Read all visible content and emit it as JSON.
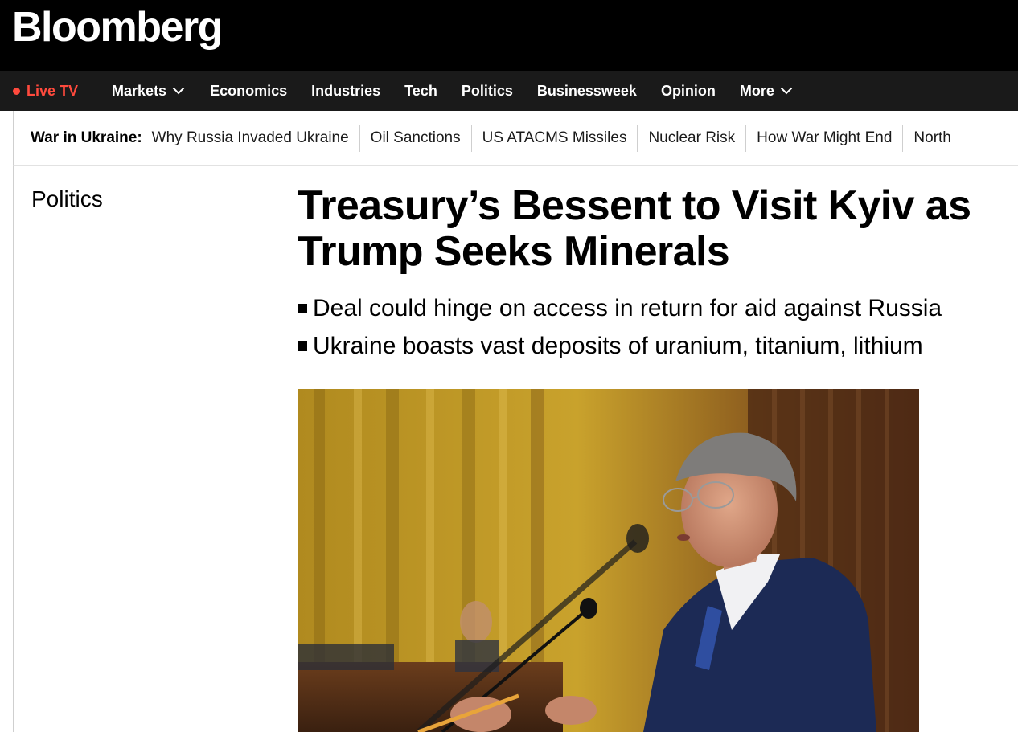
{
  "brand": {
    "logo": "Bloomberg"
  },
  "nav": {
    "live_tv": "Live TV",
    "items": [
      {
        "label": "Markets",
        "dropdown": true
      },
      {
        "label": "Economics"
      },
      {
        "label": "Industries"
      },
      {
        "label": "Tech"
      },
      {
        "label": "Politics"
      },
      {
        "label": "Businessweek"
      },
      {
        "label": "Opinion"
      },
      {
        "label": "More",
        "dropdown": true
      }
    ]
  },
  "topic_strip": {
    "label": "War in Ukraine:",
    "links": [
      "Why Russia Invaded Ukraine",
      "Oil Sanctions",
      "US ATACMS Missiles",
      "Nuclear Risk",
      "How War Might End",
      "North"
    ]
  },
  "article": {
    "section": "Politics",
    "headline": "Treasury’s Bessent to Visit Kyiv as Trump Seeks Minerals",
    "bullets": [
      "Deal could hinge on access in return for aid against Russia",
      "Ukraine boasts vast deposits of uranium, titanium, lithium"
    ]
  },
  "colors": {
    "masthead_bg": "#000000",
    "nav_bg": "#1a1a1a",
    "live_accent": "#ff4a3d"
  }
}
